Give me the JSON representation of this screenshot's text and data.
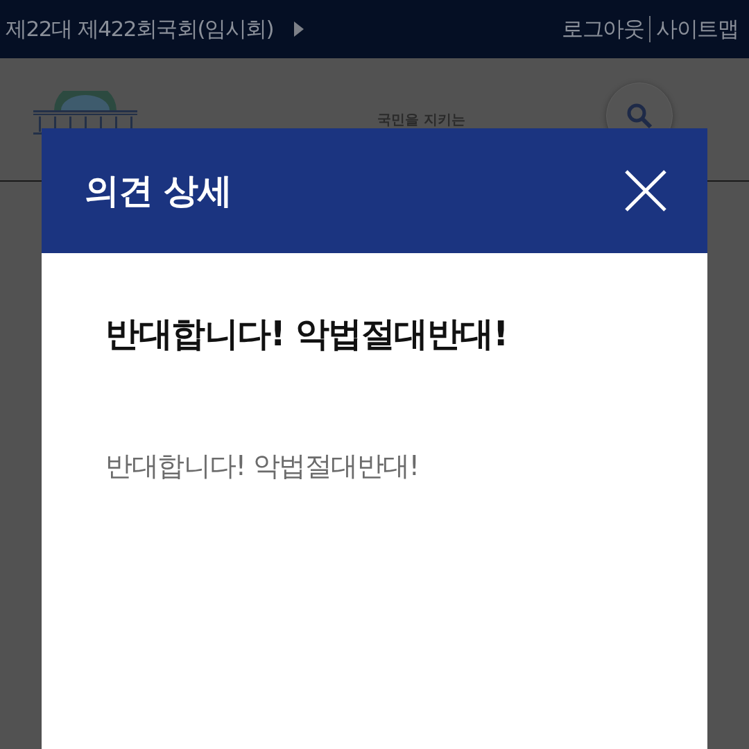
{
  "top_bar": {
    "session": "제22대 제422회국회(임시회)",
    "links": [
      "로그아웃",
      "사이트맵"
    ]
  },
  "site_header": {
    "slogan": "국민을 지키는"
  },
  "modal": {
    "title": "의견 상세",
    "heading": "반대합니다! 악법절대반대!",
    "body": "반대합니다! 악법절대반대!"
  }
}
